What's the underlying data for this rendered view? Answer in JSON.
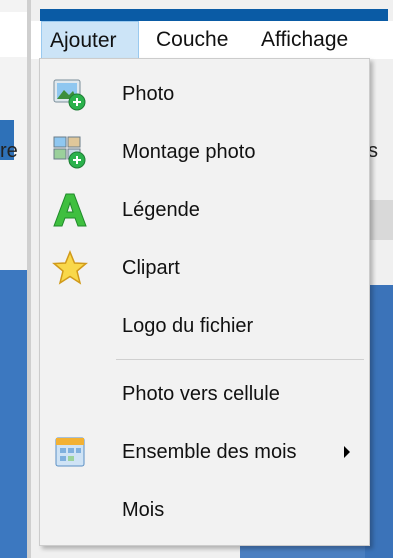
{
  "menubar": {
    "items": [
      {
        "label": "Ajouter"
      },
      {
        "label": "Couche"
      },
      {
        "label": "Affichage"
      }
    ]
  },
  "background": {
    "left_fragment": "re",
    "right_fragment": "s"
  },
  "dropdown": {
    "items": [
      {
        "label": "Photo",
        "icon": "photo-add-icon"
      },
      {
        "label": "Montage photo",
        "icon": "photo-montage-add-icon"
      },
      {
        "label": "Légende",
        "icon": "caption-A-icon"
      },
      {
        "label": "Clipart",
        "icon": "star-icon"
      },
      {
        "label": "Logo du fichier"
      },
      {
        "label": "Photo vers cellule"
      },
      {
        "label": "Ensemble des mois",
        "icon": "calendar-icon",
        "has_submenu": true
      },
      {
        "label": "Mois"
      }
    ]
  },
  "colors": {
    "accent": "#0a5ba5",
    "menu_highlight": "#cce4f7",
    "add_badge": "#2bb24c"
  }
}
